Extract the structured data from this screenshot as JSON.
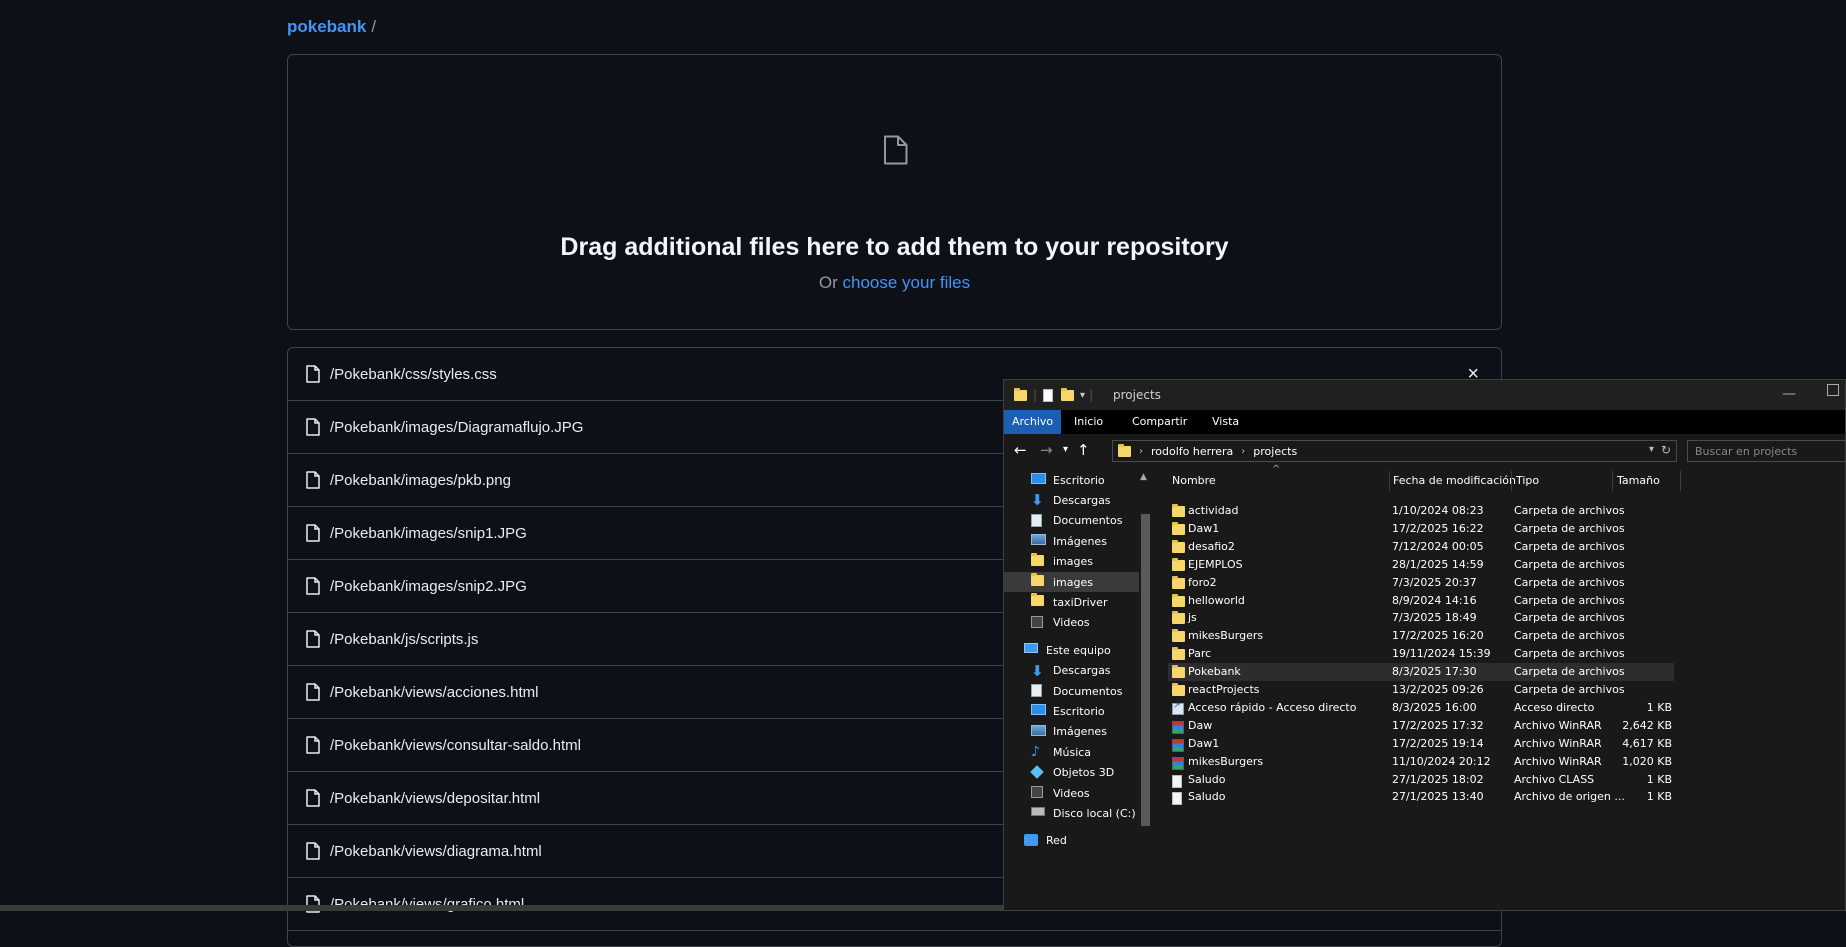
{
  "github": {
    "breadcrumb": {
      "repo": "pokebank",
      "separator": "/"
    },
    "dropzone": {
      "headline": "Drag additional files here to add them to your repository",
      "prefix": "Or",
      "link": "choose your files"
    },
    "files": [
      "/Pokebank/css/styles.css",
      "/Pokebank/images/Diagramaflujo.JPG",
      "/Pokebank/images/pkb.png",
      "/Pokebank/images/snip1.JPG",
      "/Pokebank/images/snip2.JPG",
      "/Pokebank/js/scripts.js",
      "/Pokebank/views/acciones.html",
      "/Pokebank/views/consultar-saldo.html",
      "/Pokebank/views/depositar.html",
      "/Pokebank/views/diagrama.html",
      "/Pokebank/views/grafico.html"
    ],
    "remove_label": "×"
  },
  "explorer": {
    "title": "projects",
    "ribbon": [
      "Archivo",
      "Inicio",
      "Compartir",
      "Vista"
    ],
    "address": {
      "seg1": "rodolfo herrera",
      "seg2": "projects"
    },
    "search_placeholder": "Buscar en projects",
    "sidebar": [
      {
        "label": "Escritorio",
        "icon": "desktop-icon",
        "pinned": true
      },
      {
        "label": "Descargas",
        "icon": "download-icon",
        "pinned": true
      },
      {
        "label": "Documentos",
        "icon": "documents-icon",
        "pinned": true
      },
      {
        "label": "Imágenes",
        "icon": "pictures-icon",
        "pinned": true
      },
      {
        "label": "images",
        "icon": "folder-icon",
        "pinned": false
      },
      {
        "label": "images",
        "icon": "folder-icon",
        "pinned": false,
        "selected": true
      },
      {
        "label": "taxiDriver",
        "icon": "folder-icon",
        "pinned": false
      },
      {
        "label": "Videos",
        "icon": "videos-icon",
        "pinned": false
      },
      {
        "label": "Este equipo",
        "icon": "computer-icon",
        "pinned": false,
        "root": true
      },
      {
        "label": "Descargas",
        "icon": "download-icon",
        "pinned": false
      },
      {
        "label": "Documentos",
        "icon": "documents-icon",
        "pinned": false
      },
      {
        "label": "Escritorio",
        "icon": "desktop-icon",
        "pinned": false
      },
      {
        "label": "Imágenes",
        "icon": "pictures-icon",
        "pinned": false
      },
      {
        "label": "Música",
        "icon": "music-icon",
        "pinned": false
      },
      {
        "label": "Objetos 3D",
        "icon": "3d-objects-icon",
        "pinned": false
      },
      {
        "label": "Videos",
        "icon": "videos-icon",
        "pinned": false
      },
      {
        "label": "Disco local (C:)",
        "icon": "disk-icon",
        "pinned": false
      },
      {
        "label": "Red",
        "icon": "network-icon",
        "pinned": false,
        "root": true
      }
    ],
    "columns": {
      "name": "Nombre",
      "date": "Fecha de modificación",
      "type": "Tipo",
      "size": "Tamaño"
    },
    "rows": [
      {
        "name": "actividad",
        "date": "1/10/2024 08:23",
        "type": "Carpeta de archivos",
        "size": "",
        "icon": "folder-icon"
      },
      {
        "name": "Daw1",
        "date": "17/2/2025 16:22",
        "type": "Carpeta de archivos",
        "size": "",
        "icon": "folder-icon"
      },
      {
        "name": "desafio2",
        "date": "7/12/2024 00:05",
        "type": "Carpeta de archivos",
        "size": "",
        "icon": "folder-icon"
      },
      {
        "name": "EJEMPLOS",
        "date": "28/1/2025 14:59",
        "type": "Carpeta de archivos",
        "size": "",
        "icon": "folder-icon"
      },
      {
        "name": "foro2",
        "date": "7/3/2025 20:37",
        "type": "Carpeta de archivos",
        "size": "",
        "icon": "folder-icon"
      },
      {
        "name": "helloworld",
        "date": "8/9/2024 14:16",
        "type": "Carpeta de archivos",
        "size": "",
        "icon": "folder-icon"
      },
      {
        "name": "js",
        "date": "7/3/2025 18:49",
        "type": "Carpeta de archivos",
        "size": "",
        "icon": "folder-icon"
      },
      {
        "name": "mikesBurgers",
        "date": "17/2/2025 16:20",
        "type": "Carpeta de archivos",
        "size": "",
        "icon": "folder-icon"
      },
      {
        "name": "Parc",
        "date": "19/11/2024 15:39",
        "type": "Carpeta de archivos",
        "size": "",
        "icon": "folder-icon"
      },
      {
        "name": "Pokebank",
        "date": "8/3/2025 17:30",
        "type": "Carpeta de archivos",
        "size": "",
        "icon": "folder-icon",
        "highlight": true
      },
      {
        "name": "reactProjects",
        "date": "13/2/2025 09:26",
        "type": "Carpeta de archivos",
        "size": "",
        "icon": "folder-icon"
      },
      {
        "name": "Acceso rápido - Acceso directo",
        "date": "8/3/2025 16:00",
        "type": "Acceso directo",
        "size": "1 KB",
        "icon": "shortcut-icon"
      },
      {
        "name": "Daw",
        "date": "17/2/2025 17:32",
        "type": "Archivo WinRAR",
        "size": "2,642 KB",
        "icon": "winrar-icon"
      },
      {
        "name": "Daw1",
        "date": "17/2/2025 19:14",
        "type": "Archivo WinRAR",
        "size": "4,617 KB",
        "icon": "winrar-icon"
      },
      {
        "name": "mikesBurgers",
        "date": "11/10/2024 20:12",
        "type": "Archivo WinRAR",
        "size": "1,020 KB",
        "icon": "winrar-icon"
      },
      {
        "name": "Saludo",
        "date": "27/1/2025 18:02",
        "type": "Archivo CLASS",
        "size": "1 KB",
        "icon": "file-icon"
      },
      {
        "name": "Saludo",
        "date": "27/1/2025 13:40",
        "type": "Archivo de origen ...",
        "size": "1 KB",
        "icon": "file-icon"
      }
    ]
  }
}
